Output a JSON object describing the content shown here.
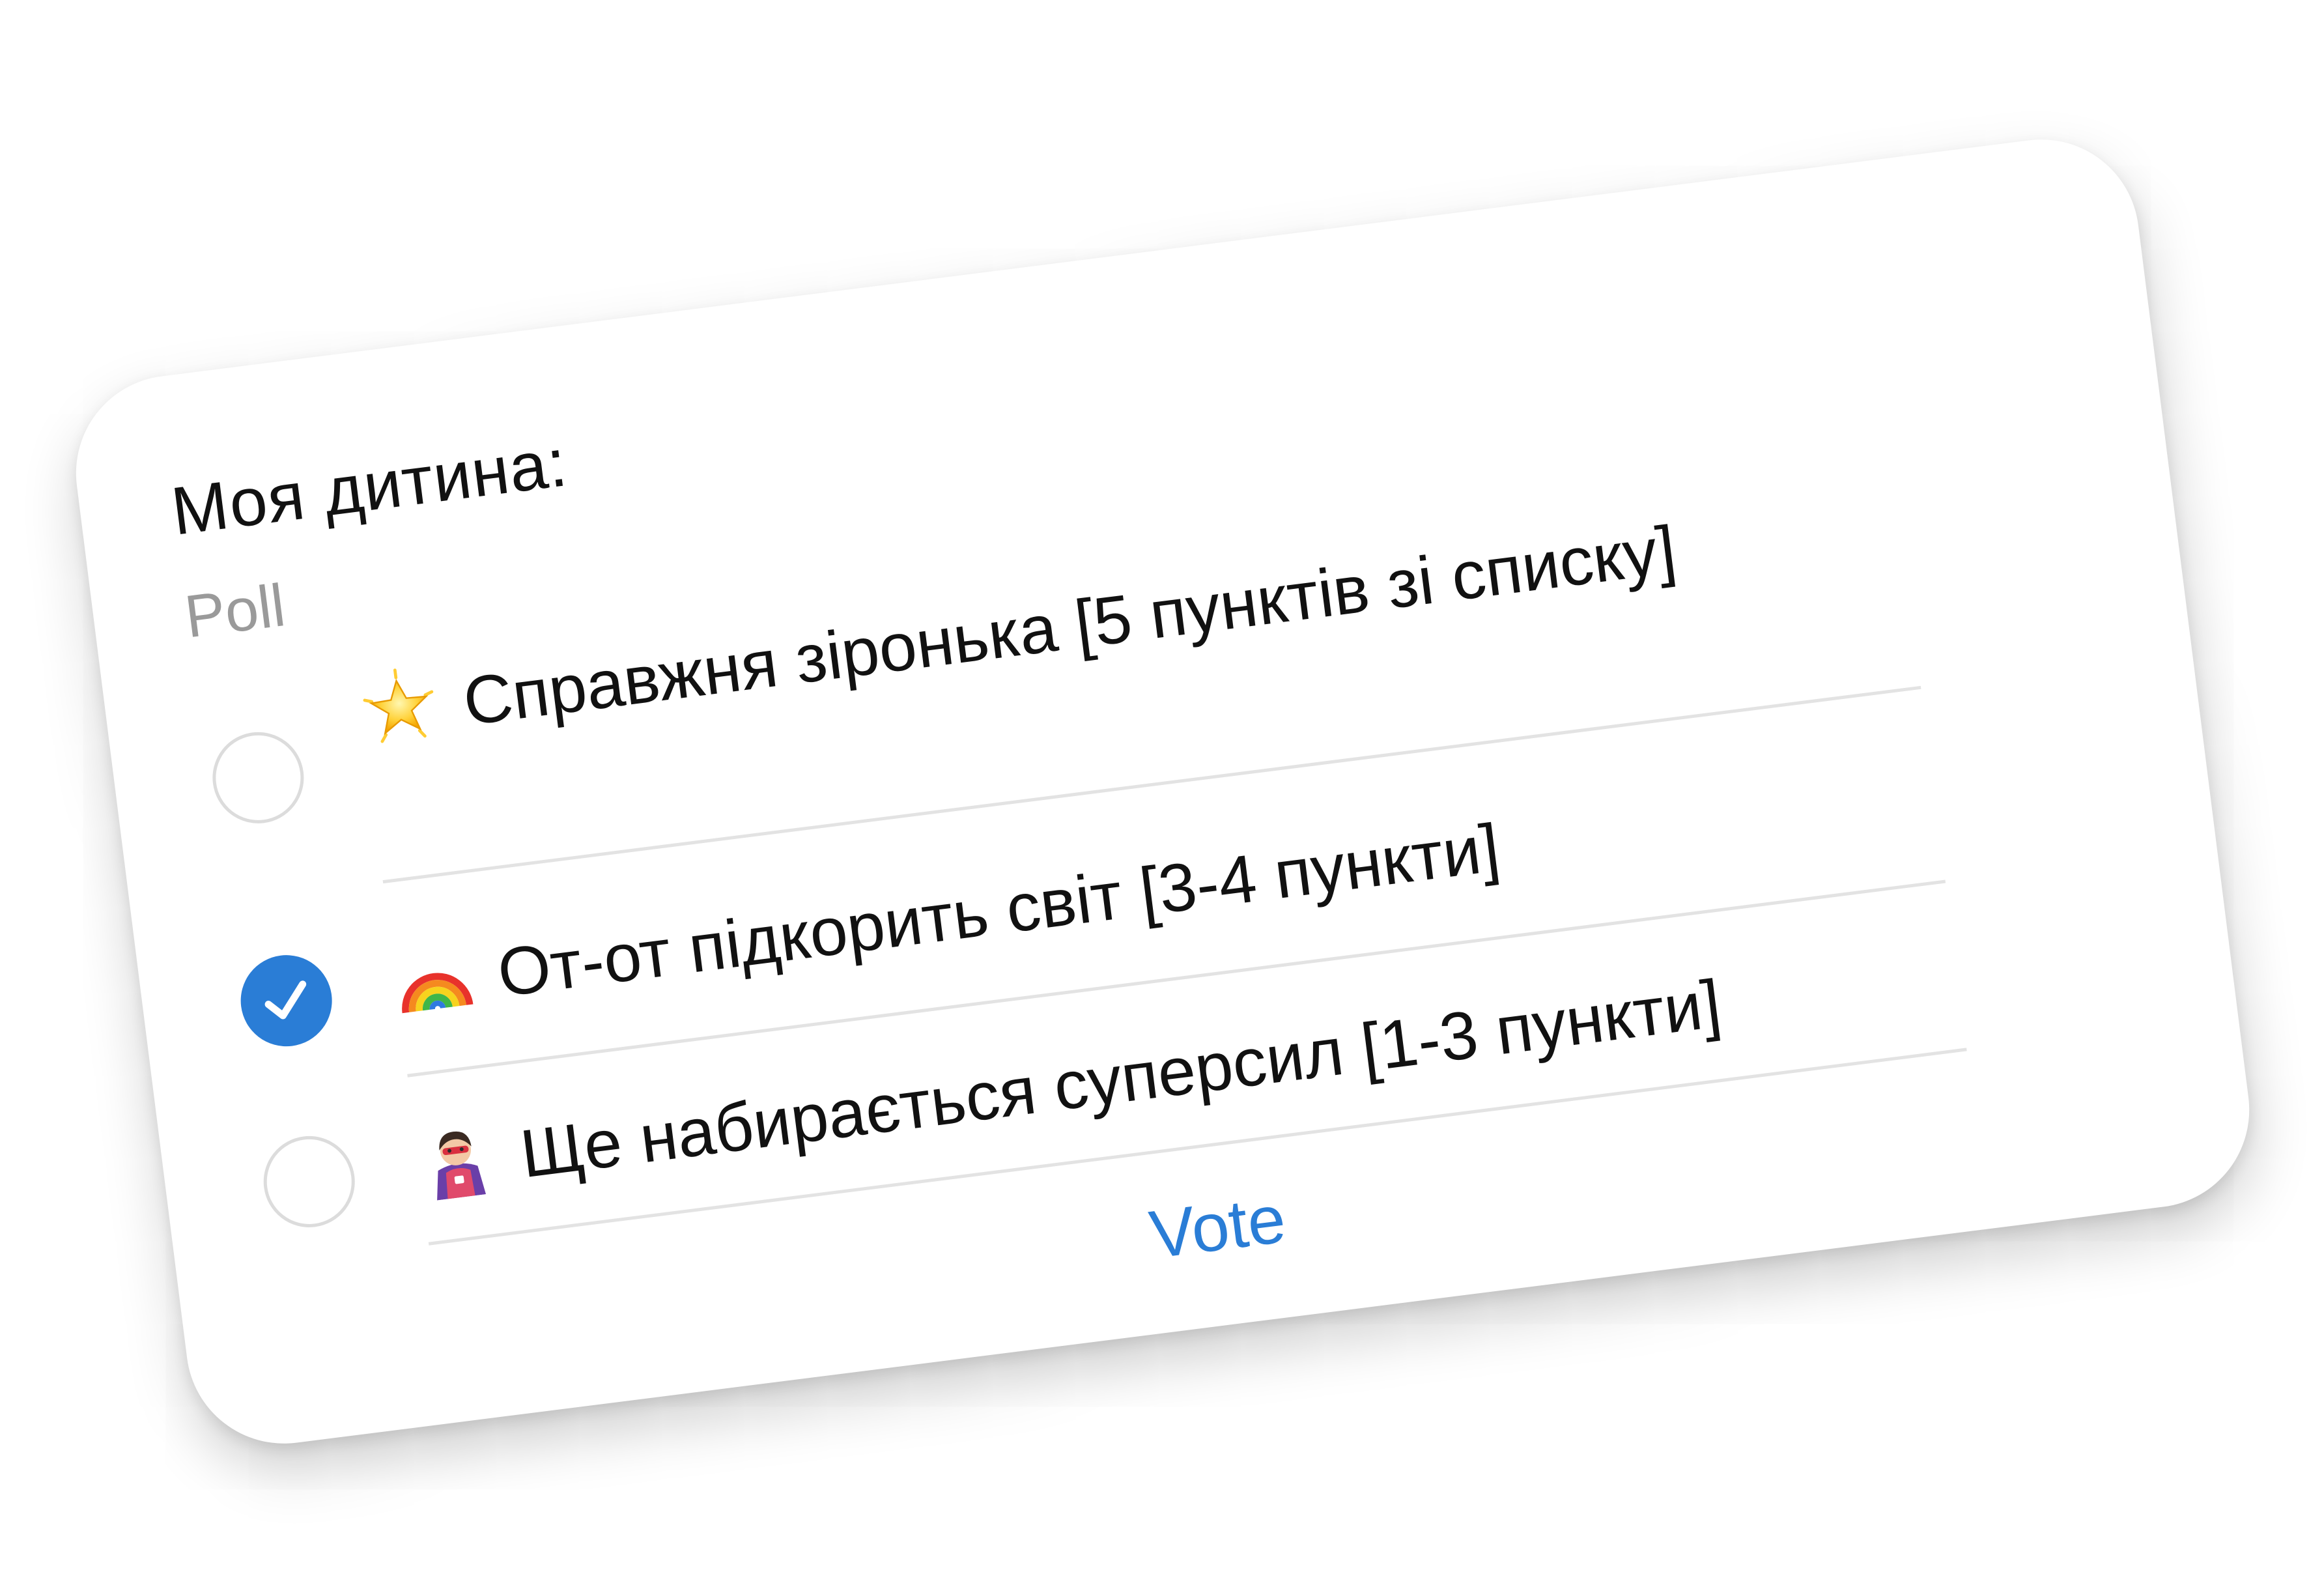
{
  "poll": {
    "title": "Моя дитина:",
    "subtitle": "Poll",
    "options": [
      {
        "emoji": "glowing-star-icon",
        "label": "Справжня зіронька  [5 пунктів зі списку]",
        "selected": false
      },
      {
        "emoji": "rainbow-icon",
        "label": "От-от підкорить світ [3-4 пункти]",
        "selected": true
      },
      {
        "emoji": "superhero-icon",
        "label": "Ще набирається суперсил [1-3 пункти]",
        "selected": false
      }
    ],
    "vote_label": "Vote"
  },
  "colors": {
    "accent": "#2a7dd6",
    "text": "#111111",
    "muted": "#9a9a9a",
    "divider": "#e3e3e3"
  }
}
